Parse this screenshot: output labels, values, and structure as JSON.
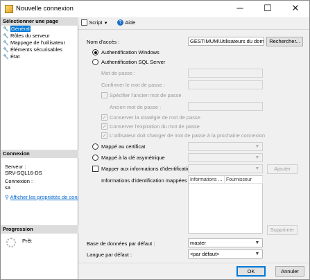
{
  "window": {
    "title": "Nouvelle connexion",
    "minimize_glyph": "─",
    "maximize_glyph": "☐",
    "close_glyph": "✕"
  },
  "left": {
    "select_page_header": "Sélectionner une page",
    "pages": [
      {
        "label": "Général",
        "selected": true
      },
      {
        "label": "Rôles du serveur",
        "selected": false
      },
      {
        "label": "Mappage de l'utilisateur",
        "selected": false
      },
      {
        "label": "Éléments sécurisables",
        "selected": false
      },
      {
        "label": "État",
        "selected": false
      }
    ],
    "connection_header": "Connexion",
    "server_label": "Serveur :",
    "server_value": "SRV-SQL16-DS",
    "connection_label": "Connexion :",
    "connection_value": "sa",
    "view_properties_link": "Afficher les propriétés de conn",
    "progress_header": "Progression",
    "progress_status": "Prêt"
  },
  "toolbar": {
    "script_label": "Script",
    "help_label": "Aide"
  },
  "form": {
    "login_name_label": "Nom d'accès :",
    "login_name_value": "GESTIMUM\\Utilisateurs du domai",
    "search_button": "Rechercher...",
    "windows_auth_label": "Authentification Windows",
    "sql_auth_label": "Authentification SQL Server",
    "password_label": "Mot de passe :",
    "confirm_password_label": "Confirmer le mot de passe :",
    "specify_old_password_label": "Spécifier l'ancien mot de passe",
    "old_password_label": "Ancien mot de passe :",
    "enforce_policy_label": "Conserver la stratégie de mot de passe",
    "enforce_expiration_label": "Conserver l'expiration du mot de passe",
    "must_change_label": "L'utilisateur doit changer de mot de passe à la prochaine connexion",
    "cert_mapped_label": "Mappé au certificat",
    "asym_key_mapped_label": "Mappé à la clé asymétrique",
    "map_credentials_label": "Mapper aux informations d'identification",
    "add_button": "Ajouter",
    "mapped_credentials_label": "Informations d'identification mappées",
    "grid_col_1": "Informations ...",
    "grid_col_2": "Fournisseur",
    "remove_button": "Supprimer",
    "default_db_label": "Base de données par défaut :",
    "default_db_value": "master",
    "default_lang_label": "Langue par défaut :",
    "default_lang_value": "<par défaut>"
  },
  "footer": {
    "ok_button": "OK",
    "cancel_button": "Annuler"
  }
}
